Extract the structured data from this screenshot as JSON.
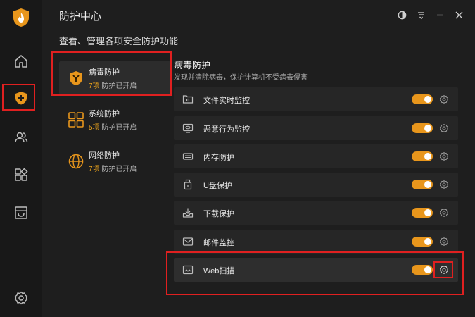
{
  "app": {
    "title": "防护中心",
    "subtitle": "查看、管理各项安全防护功能",
    "brand_color": "#e8961c"
  },
  "sidebar": {
    "items": [
      {
        "icon": "home-icon"
      },
      {
        "icon": "shield-plus-icon",
        "active": true
      },
      {
        "icon": "users-icon"
      },
      {
        "icon": "apps-icon"
      },
      {
        "icon": "bag-icon"
      }
    ],
    "bottom_icon": "settings-icon"
  },
  "window_controls": [
    "theme-icon",
    "menu-icon",
    "minimize-icon",
    "close-icon"
  ],
  "categories": [
    {
      "name": "病毒防护",
      "count": "7项",
      "status": "防护已开启",
      "active": true
    },
    {
      "name": "系统防护",
      "count": "5项",
      "status": "防护已开启"
    },
    {
      "name": "网络防护",
      "count": "7项",
      "status": "防护已开启"
    }
  ],
  "section": {
    "title": "病毒防护",
    "description": "发现并清除病毒，保护计算机不受病毒侵害"
  },
  "features": [
    {
      "label": "文件实时监控",
      "icon": "folder-icon",
      "enabled": true
    },
    {
      "label": "恶意行为监控",
      "icon": "monitor-icon",
      "enabled": true
    },
    {
      "label": "内存防护",
      "icon": "memory-icon",
      "enabled": true
    },
    {
      "label": "U盘保护",
      "icon": "usb-icon",
      "enabled": true
    },
    {
      "label": "下载保护",
      "icon": "download-icon",
      "enabled": true
    },
    {
      "label": "邮件监控",
      "icon": "mail-icon",
      "enabled": true
    },
    {
      "label": "Web扫描",
      "icon": "web-icon",
      "enabled": true
    }
  ]
}
